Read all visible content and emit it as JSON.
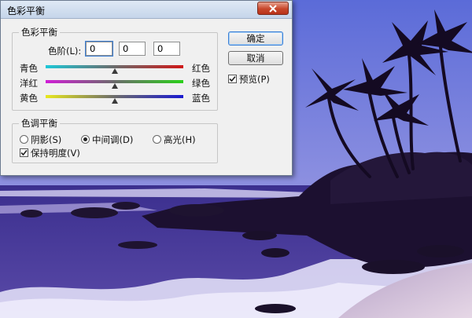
{
  "dialog": {
    "title": "色彩平衡",
    "color_balance_group": {
      "legend": "色彩平衡",
      "levels_label": "色阶(L):",
      "levels": [
        "0",
        "0",
        "0"
      ],
      "sliders": [
        {
          "left": "青色",
          "right": "红色",
          "value": 0
        },
        {
          "left": "洋红",
          "right": "绿色",
          "value": 0
        },
        {
          "left": "黄色",
          "right": "蓝色",
          "value": 0
        }
      ]
    },
    "tone_group": {
      "legend": "色调平衡",
      "options": [
        "阴影(S)",
        "中间调(D)",
        "高光(H)"
      ],
      "selected": "中间调(D)",
      "preserve_luminosity": "保持明度(V)",
      "preserve_checked": true
    },
    "buttons": {
      "ok": "确定",
      "cancel": "取消"
    },
    "preview": {
      "label": "预览(P)",
      "checked": true
    }
  }
}
